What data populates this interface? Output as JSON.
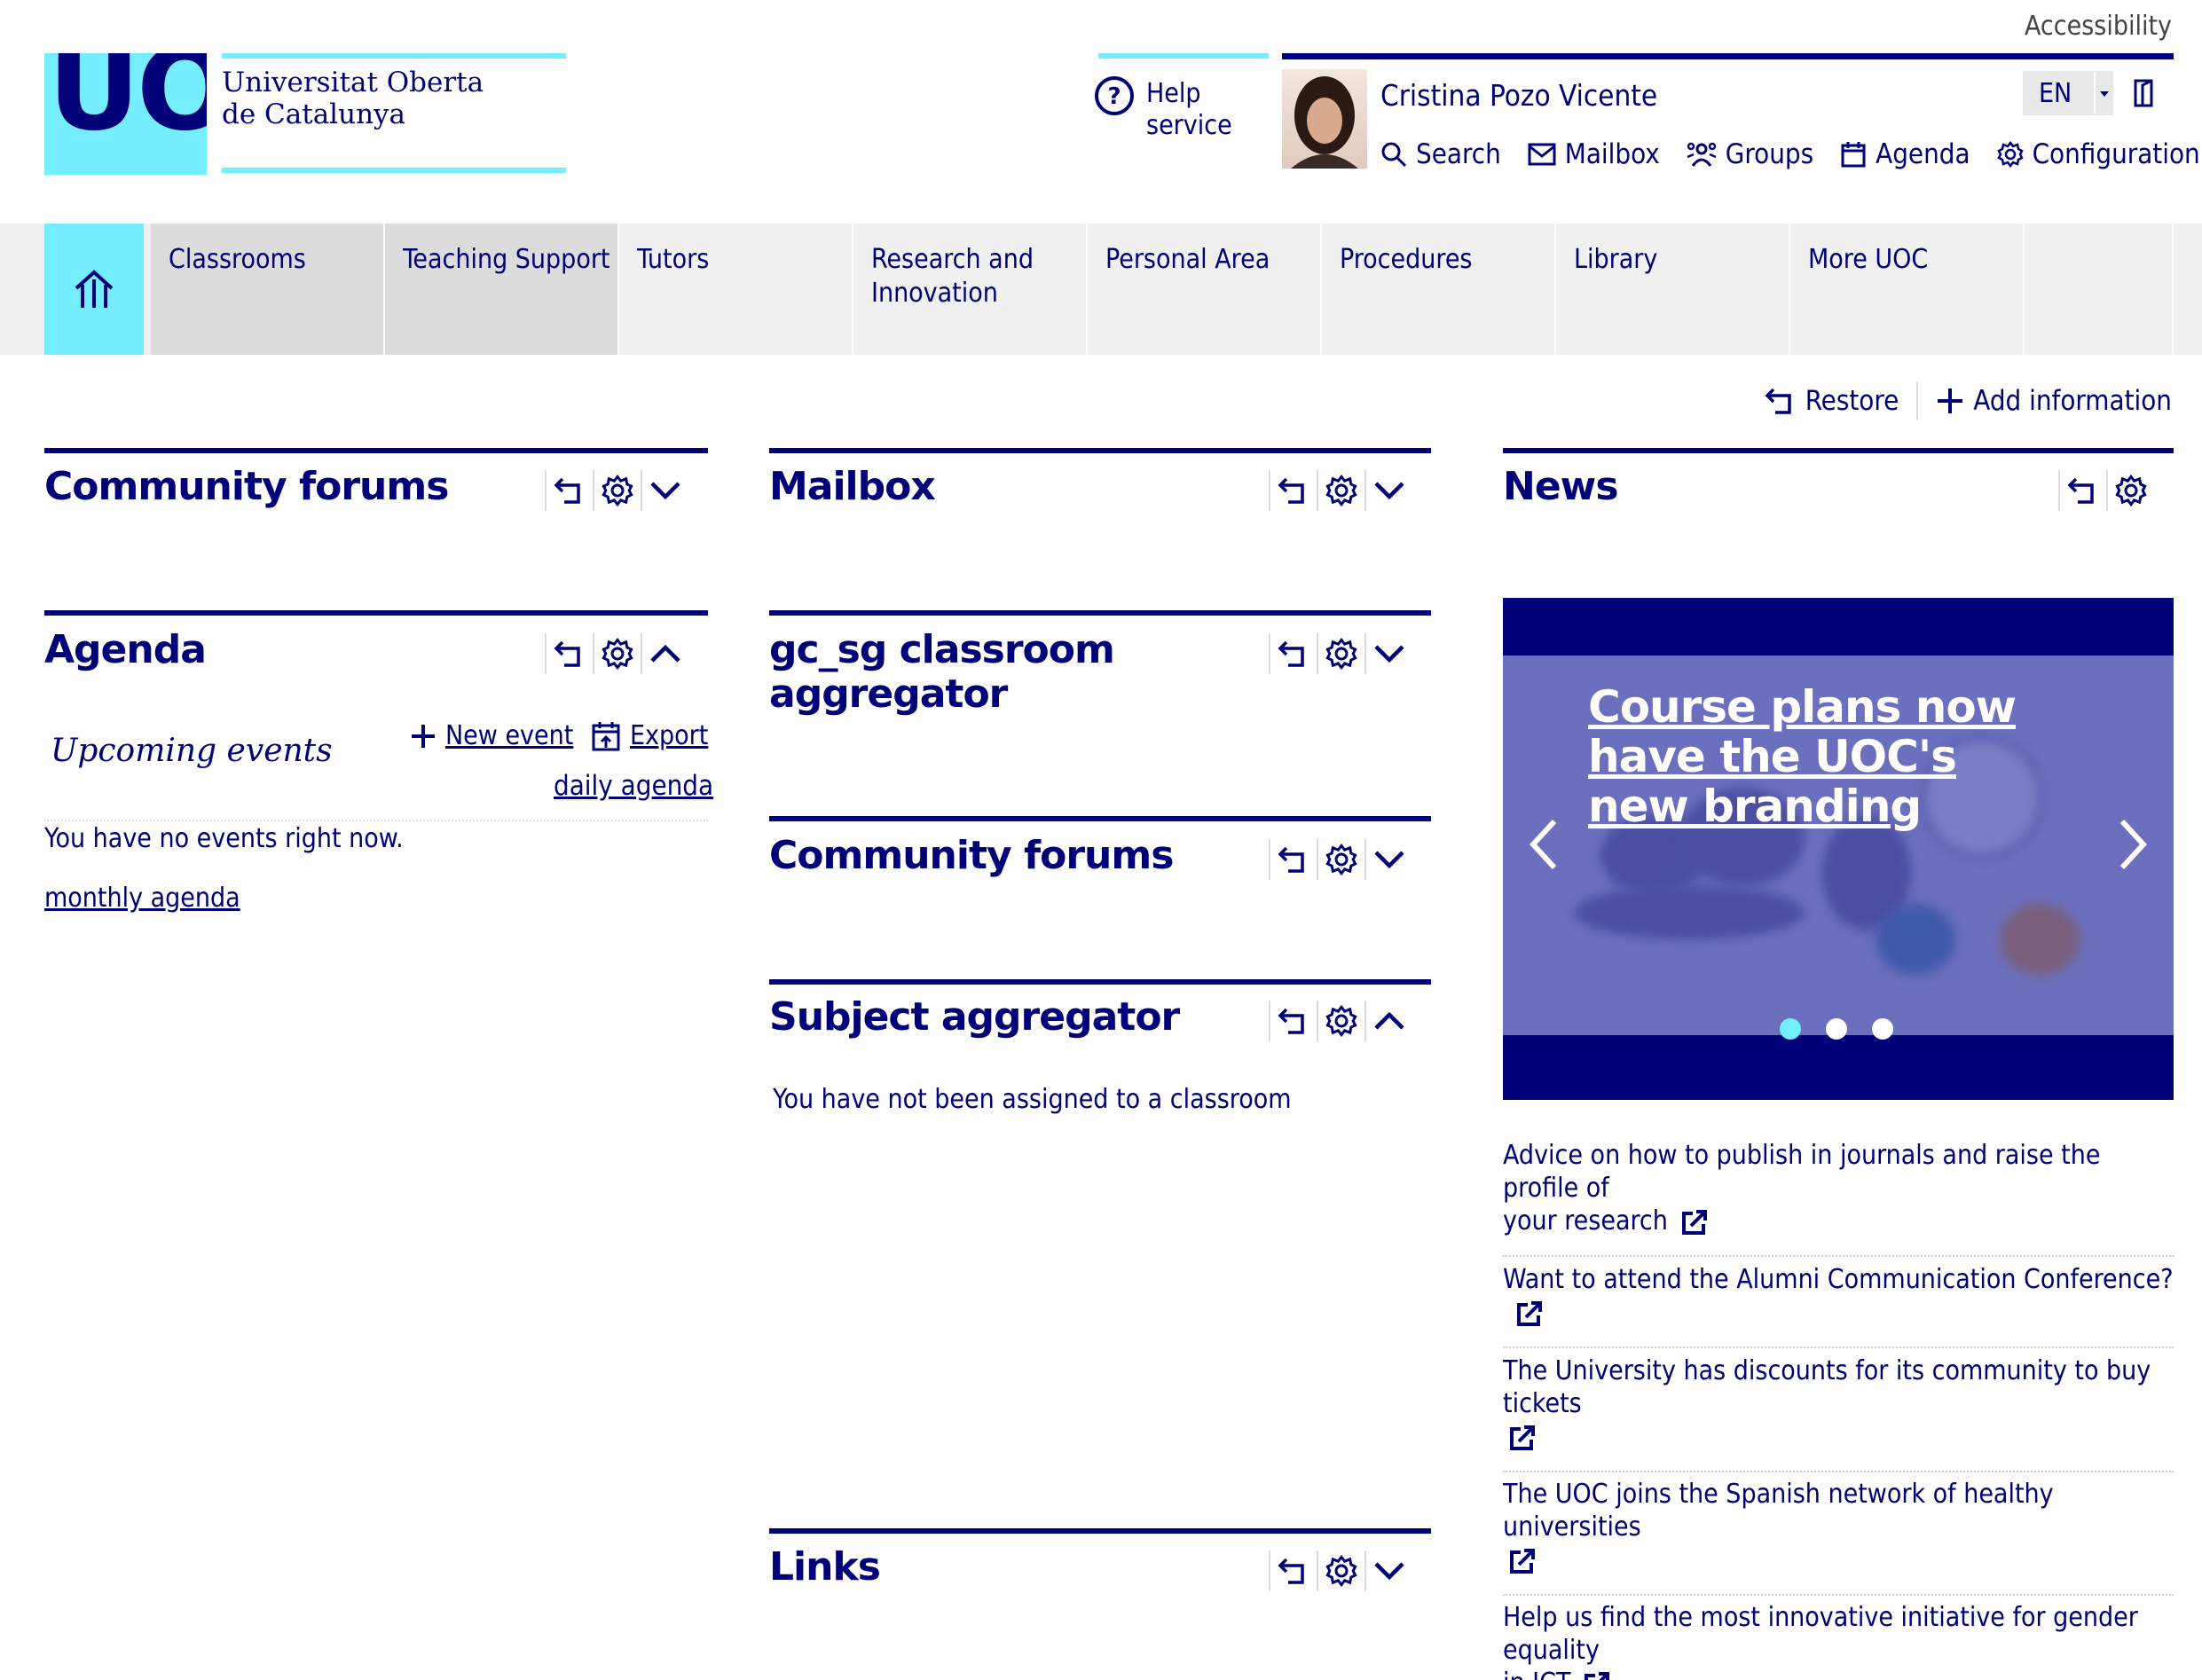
{
  "header": {
    "accessibility": "Accessibility",
    "logo_letters": "UOC",
    "logo_name_line1": "Universitat Oberta",
    "logo_name_line2": "de Catalunya",
    "help_line1": "Help",
    "help_line2": "service",
    "user_name": "Cristina Pozo Vicente",
    "language": "EN",
    "links": {
      "search": "Search",
      "mailbox": "Mailbox",
      "groups": "Groups",
      "agenda": "Agenda",
      "configuration": "Configuration"
    }
  },
  "nav": {
    "classrooms": "Classrooms",
    "teaching_support": "Teaching Support",
    "tutors": "Tutors",
    "research_line1": "Research and",
    "research_line2": "Innovation",
    "personal_area": "Personal Area",
    "procedures": "Procedures",
    "library": "Library",
    "more_uoc": "More UOC"
  },
  "actions": {
    "restore": "Restore",
    "add_information": "Add information"
  },
  "widgets": {
    "community_forums_1": "Community forums",
    "agenda": "Agenda",
    "upcoming_events": "Upcoming events",
    "new_event": "New event",
    "export": "Export",
    "daily_agenda": "daily agenda",
    "no_events": "You have no events right now.",
    "monthly_agenda": "monthly agenda",
    "mailbox": "Mailbox",
    "classroom_aggregator_line1": "gc_sg classroom",
    "classroom_aggregator_line2": "aggregator",
    "community_forums_2": "Community forums",
    "subject_aggregator": "Subject aggregator",
    "no_classroom": "You have not been assigned to a classroom",
    "links": "Links",
    "news": "News"
  },
  "news": {
    "slide_title": "Course plans now have the UOC's new branding",
    "active_slide": 1,
    "slide_count": 3,
    "items": [
      {
        "line1": "Advice on how to publish in journals and raise the profile of",
        "line2": "your research"
      },
      {
        "line1": "Want to attend the Alumni Communication Conference?",
        "line2": ""
      },
      {
        "line1": "The University has discounts for its community to buy tickets",
        "line2": ""
      },
      {
        "line1": "The UOC joins the Spanish network of healthy universities",
        "line2": ""
      },
      {
        "line1": "Help us find the most innovative initiative for gender equality",
        "line2": "in ICT"
      }
    ]
  },
  "colors": {
    "navy": "#000078",
    "cyan": "#73edff",
    "nav_bg": "#f0f0f0",
    "nav_active": "#dcdcdc"
  }
}
